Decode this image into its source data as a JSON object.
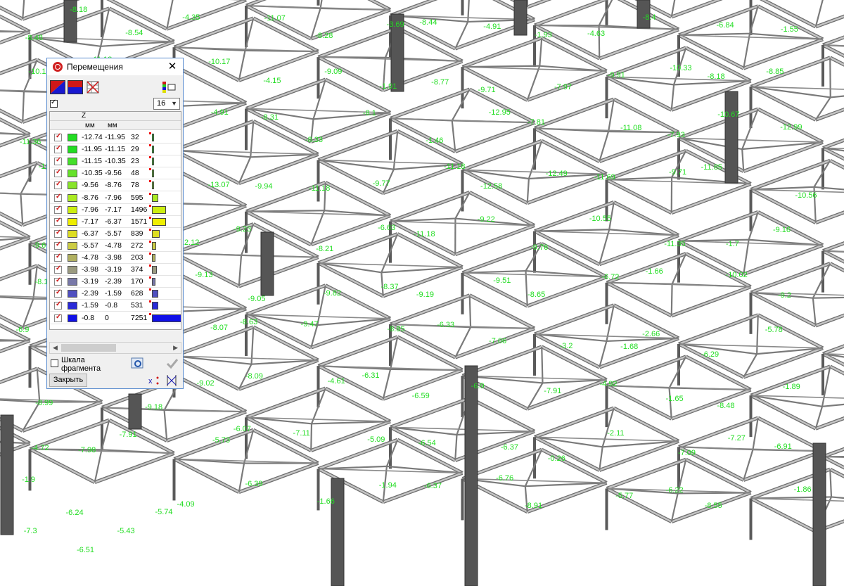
{
  "dialog": {
    "title": "Перемещения",
    "column_header_component": "Z",
    "col_unit_from": "мм",
    "col_unit_to": "мм",
    "levels_count": "16",
    "scale_fragment_label_line1": "Шкала",
    "scale_fragment_label_line2": "фрагмента",
    "close_button_label": "Закрыть",
    "rows": [
      {
        "from": "-12.74",
        "to": "-11.95",
        "count": "32",
        "color": "#22dd22"
      },
      {
        "from": "-11.95",
        "to": "-11.15",
        "count": "29",
        "color": "#22dd22"
      },
      {
        "from": "-11.15",
        "to": "-10.35",
        "count": "23",
        "color": "#44e02a"
      },
      {
        "from": "-10.35",
        "to": "-9.56",
        "count": "48",
        "color": "#66e22a"
      },
      {
        "from": "-9.56",
        "to": "-8.76",
        "count": "78",
        "color": "#88e42a"
      },
      {
        "from": "-8.76",
        "to": "-7.96",
        "count": "595",
        "color": "#aaea22"
      },
      {
        "from": "-7.96",
        "to": "-7.17",
        "count": "1496",
        "color": "#ccee10"
      },
      {
        "from": "-7.17",
        "to": "-6.37",
        "count": "1571",
        "color": "#eeee00"
      },
      {
        "from": "-6.37",
        "to": "-5.57",
        "count": "839",
        "color": "#dddd22"
      },
      {
        "from": "-5.57",
        "to": "-4.78",
        "count": "272",
        "color": "#cccc44"
      },
      {
        "from": "-4.78",
        "to": "-3.98",
        "count": "203",
        "color": "#b0b060"
      },
      {
        "from": "-3.98",
        "to": "-3.19",
        "count": "374",
        "color": "#9a9a80"
      },
      {
        "from": "-3.19",
        "to": "-2.39",
        "count": "170",
        "color": "#7878a8"
      },
      {
        "from": "-2.39",
        "to": "-1.59",
        "count": "628",
        "color": "#5050c0"
      },
      {
        "from": "-1.59",
        "to": "-0.8",
        "count": "531",
        "color": "#2a2ad8"
      },
      {
        "from": "-0.8",
        "to": "0",
        "count": "7251",
        "color": "#1010e8"
      }
    ]
  },
  "model_labels": [
    {
      "text": "-8.48"
    },
    {
      "text": "-8.18"
    },
    {
      "text": "-8.54"
    },
    {
      "text": "-4.35"
    },
    {
      "text": "-11.07"
    },
    {
      "text": "-8.28"
    },
    {
      "text": "-3.69"
    },
    {
      "text": "-8.44"
    },
    {
      "text": "-4.91"
    },
    {
      "text": "-1.93"
    },
    {
      "text": "-4.63"
    },
    {
      "text": "-8.4"
    },
    {
      "text": "-6.84"
    },
    {
      "text": "-1.55"
    },
    {
      "text": "-10.1"
    },
    {
      "text": "-11.18"
    },
    {
      "text": "-10.39"
    },
    {
      "text": "-10.17"
    },
    {
      "text": "-4.15"
    },
    {
      "text": "-9.09"
    },
    {
      "text": "-1.91"
    },
    {
      "text": "-8.77"
    },
    {
      "text": "-9.71"
    },
    {
      "text": "-7.97"
    },
    {
      "text": "-9.91"
    },
    {
      "text": "-10.33"
    },
    {
      "text": "-8.18"
    },
    {
      "text": "-8.85"
    },
    {
      "text": "-11.36"
    },
    {
      "text": "-12.56"
    },
    {
      "text": "-4.69"
    },
    {
      "text": "-4.91"
    },
    {
      "text": "-8.31"
    },
    {
      "text": "-8.33"
    },
    {
      "text": "-8.1"
    },
    {
      "text": "-1.46"
    },
    {
      "text": "-12.95"
    },
    {
      "text": "-7.81"
    },
    {
      "text": "-11.08"
    },
    {
      "text": "-7.93"
    },
    {
      "text": "-10.67"
    },
    {
      "text": "-12.99"
    },
    {
      "text": "-12.51"
    },
    {
      "text": "-8.28"
    },
    {
      "text": "-9.38"
    },
    {
      "text": "-13.07"
    },
    {
      "text": "-9.94"
    },
    {
      "text": "-11.18"
    },
    {
      "text": "-9.77"
    },
    {
      "text": "-11.18"
    },
    {
      "text": "-12.58"
    },
    {
      "text": "-12.49"
    },
    {
      "text": "-11.69"
    },
    {
      "text": "-9.71"
    },
    {
      "text": "-11.85"
    },
    {
      "text": "-10.56"
    },
    {
      "text": "-9.61"
    },
    {
      "text": "-10.67"
    },
    {
      "text": "-7.84"
    },
    {
      "text": "-12.12"
    },
    {
      "text": "-9.23"
    },
    {
      "text": "-8.21"
    },
    {
      "text": "-6.63"
    },
    {
      "text": "-11.18"
    },
    {
      "text": "-9.22"
    },
    {
      "text": "-9.76"
    },
    {
      "text": "-10.55"
    },
    {
      "text": "-11.35"
    },
    {
      "text": "-1.7"
    },
    {
      "text": "-9.16"
    },
    {
      "text": "-8.1"
    },
    {
      "text": "-9.01"
    },
    {
      "text": "-8.82"
    },
    {
      "text": "-9.13"
    },
    {
      "text": "-9.05"
    },
    {
      "text": "-9.82"
    },
    {
      "text": "-8.37"
    },
    {
      "text": "-9.19"
    },
    {
      "text": "-9.51"
    },
    {
      "text": "-8.65"
    },
    {
      "text": "-6.72"
    },
    {
      "text": "-1.66"
    },
    {
      "text": "-10.02"
    },
    {
      "text": "-9.2"
    },
    {
      "text": "-6.9"
    },
    {
      "text": "-3.98"
    },
    {
      "text": "-8.01"
    },
    {
      "text": "-8.07"
    },
    {
      "text": "-8.63"
    },
    {
      "text": "-9.47"
    },
    {
      "text": "-8.85"
    },
    {
      "text": "-6.33"
    },
    {
      "text": "-7.06"
    },
    {
      "text": "-3.2"
    },
    {
      "text": "-1.68"
    },
    {
      "text": "-2.66"
    },
    {
      "text": "-6.29"
    },
    {
      "text": "-5.78"
    },
    {
      "text": "-8.99"
    },
    {
      "text": "-7.91"
    },
    {
      "text": "-9.18"
    },
    {
      "text": "-9.02"
    },
    {
      "text": "-8.09"
    },
    {
      "text": "-4.61"
    },
    {
      "text": "-6.31"
    },
    {
      "text": "-6.59"
    },
    {
      "text": "-6.9"
    },
    {
      "text": "-7.91"
    },
    {
      "text": "-4.92"
    },
    {
      "text": "-1.65"
    },
    {
      "text": "-8.48"
    },
    {
      "text": "-1.89"
    },
    {
      "text": "-4.72"
    },
    {
      "text": "-7.98"
    },
    {
      "text": "-7.91"
    },
    {
      "text": "-5.73"
    },
    {
      "text": "-6.07"
    },
    {
      "text": "-7.11"
    },
    {
      "text": "-5.09"
    },
    {
      "text": "-6.54"
    },
    {
      "text": "-6.37"
    },
    {
      "text": "-0.26"
    },
    {
      "text": "-2.11"
    },
    {
      "text": "-7.09"
    },
    {
      "text": "-7.27"
    },
    {
      "text": "-6.91"
    },
    {
      "text": "-1.9"
    },
    {
      "text": "-6.24"
    },
    {
      "text": "-5.74"
    },
    {
      "text": "-4.09"
    },
    {
      "text": "-6.39"
    },
    {
      "text": "-1.66"
    },
    {
      "text": "-1.94"
    },
    {
      "text": "-6.37"
    },
    {
      "text": "-6.76"
    },
    {
      "text": "-8.91"
    },
    {
      "text": "-5.77"
    },
    {
      "text": "-6.22"
    },
    {
      "text": "-8.55"
    },
    {
      "text": "-1.86"
    },
    {
      "text": "-7.3"
    },
    {
      "text": "-6.51"
    },
    {
      "text": "-5.43"
    }
  ]
}
